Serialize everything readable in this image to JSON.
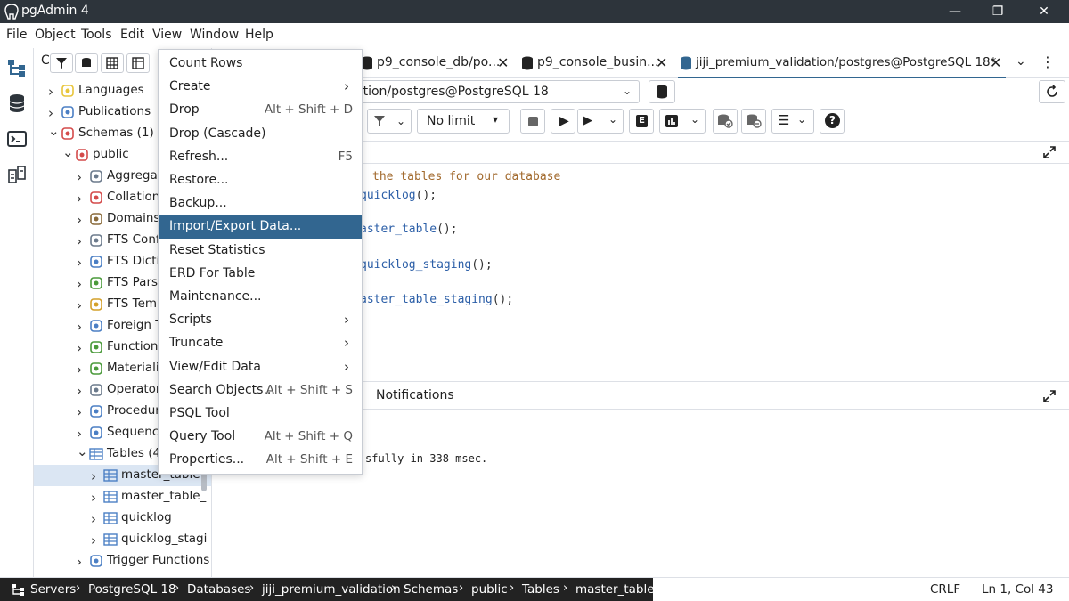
{
  "app": {
    "title": "pgAdmin 4"
  },
  "menubar": [
    "File",
    "Object",
    "Tools",
    "Edit",
    "View",
    "Window",
    "Help"
  ],
  "explorer": {
    "toolbar_partial_label": "C",
    "tree": [
      {
        "label": "Languages",
        "icon": "languages-icon"
      },
      {
        "label": "Publications",
        "icon": "publications-icon"
      },
      {
        "label": "Schemas (1)",
        "icon": "schemas-icon"
      },
      {
        "label": "public",
        "icon": "schema-icon"
      },
      {
        "label": "Aggregat",
        "icon": "aggregates-icon"
      },
      {
        "label": "Collation",
        "icon": "collations-icon"
      },
      {
        "label": "Domains",
        "icon": "domains-icon"
      },
      {
        "label": "FTS Conf",
        "icon": "fts-config-icon"
      },
      {
        "label": "FTS Dicti",
        "icon": "fts-dictionary-icon"
      },
      {
        "label": "FTS Pars",
        "icon": "fts-parser-icon"
      },
      {
        "label": "FTS Temp",
        "icon": "fts-template-icon"
      },
      {
        "label": "Foreign T",
        "icon": "foreign-tables-icon"
      },
      {
        "label": "Function",
        "icon": "functions-icon"
      },
      {
        "label": "Materiali",
        "icon": "materialized-views-icon"
      },
      {
        "label": "Operator",
        "icon": "operators-icon"
      },
      {
        "label": "Procedur",
        "icon": "procedures-icon"
      },
      {
        "label": "Sequence",
        "icon": "sequences-icon"
      },
      {
        "label": "Tables (4",
        "icon": "tables-icon"
      },
      {
        "label": "master_table",
        "icon": "table-icon"
      },
      {
        "label": "master_table_",
        "icon": "table-icon"
      },
      {
        "label": "quicklog",
        "icon": "table-icon"
      },
      {
        "label": "quicklog_stagi",
        "icon": "table-icon"
      },
      {
        "label": "Trigger Functions",
        "icon": "trigger-functions-icon"
      }
    ]
  },
  "tabs": [
    {
      "label": "p9_console_db/po...",
      "close": "✕"
    },
    {
      "label": "p9_console_busin...",
      "close": "✕"
    },
    {
      "label": "jiji_premium_validation/postgres@PostgreSQL 18*",
      "close": "✕"
    }
  ],
  "connection": {
    "value": "ation/postgres@PostgreSQL 18"
  },
  "query_toolbar": {
    "limit": "No limit"
  },
  "code_lines": [
    {
      "comment": "the tables for our database"
    },
    {
      "fn": "quicklog",
      "rest": "();"
    },
    {
      "fn": "aster_table",
      "rest": "();"
    },
    {
      "fn": "quicklog_staging",
      "rest": "();"
    },
    {
      "fn": "aster_table_staging",
      "rest": "();"
    }
  ],
  "bottom_panel": {
    "notifications_tab": "Notifications",
    "message": "sfully in 338 msec."
  },
  "context_menu": [
    {
      "label": "Count Rows",
      "shortcut": "",
      "submenu": false
    },
    {
      "label": "Create",
      "shortcut": "",
      "submenu": true
    },
    {
      "label": "Drop",
      "shortcut": "Alt + Shift + D",
      "submenu": false
    },
    {
      "label": "Drop (Cascade)",
      "shortcut": "",
      "submenu": false
    },
    {
      "label": "Refresh...",
      "shortcut": "F5",
      "submenu": false
    },
    {
      "label": "Restore...",
      "shortcut": "",
      "submenu": false
    },
    {
      "label": "Backup...",
      "shortcut": "",
      "submenu": false
    },
    {
      "label": "Import/Export Data...",
      "shortcut": "",
      "submenu": false,
      "highlighted": true
    },
    {
      "label": "Reset Statistics",
      "shortcut": "",
      "submenu": false
    },
    {
      "label": "ERD For Table",
      "shortcut": "",
      "submenu": false
    },
    {
      "label": "Maintenance...",
      "shortcut": "",
      "submenu": false
    },
    {
      "label": "Scripts",
      "shortcut": "",
      "submenu": true
    },
    {
      "label": "Truncate",
      "shortcut": "",
      "submenu": true
    },
    {
      "label": "View/Edit Data",
      "shortcut": "",
      "submenu": true
    },
    {
      "label": "Search Objects...",
      "shortcut": "Alt + Shift + S",
      "submenu": false
    },
    {
      "label": "PSQL Tool",
      "shortcut": "",
      "submenu": false
    },
    {
      "label": "Query Tool",
      "shortcut": "Alt + Shift + Q",
      "submenu": false
    },
    {
      "label": "Properties...",
      "shortcut": "Alt + Shift + E",
      "submenu": false
    }
  ],
  "breadcrumb": [
    "Servers",
    "PostgreSQL 18",
    "Databases",
    "jiji_premium_validation",
    "Schemas",
    "public",
    "Tables",
    "master_table"
  ],
  "status": {
    "line_ending": "CRLF",
    "position": "Ln 1, Col 43"
  },
  "colors": {
    "accent": "#326690",
    "titlebar": "#2d343b",
    "comment": "#a26a2e",
    "function": "#2b5ea7"
  }
}
